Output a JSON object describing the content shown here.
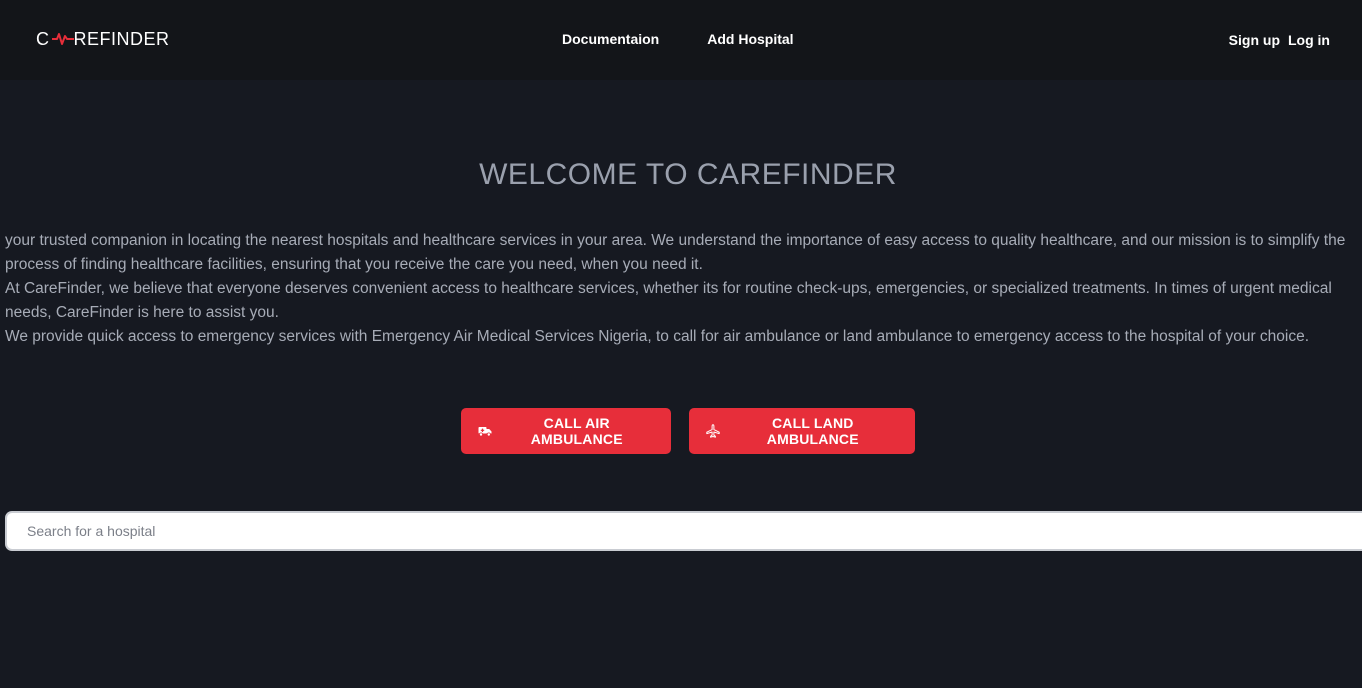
{
  "header": {
    "logo": {
      "prefix": "C",
      "suffix": "REFINDER",
      "pulse_color": "#e72e3a"
    },
    "nav": [
      {
        "label": "Documentaion"
      },
      {
        "label": "Add Hospital"
      }
    ],
    "auth": {
      "signup_label": "Sign up",
      "login_label": "Log in"
    }
  },
  "hero": {
    "title": "WELCOME TO CAREFINDER",
    "paragraphs": [
      "your trusted companion in locating the nearest hospitals and healthcare services in your area. We understand the importance of easy access to quality healthcare, and our mission is to simplify the process of finding healthcare facilities, ensuring that you receive the care you need, when you need it.",
      "At CareFinder, we believe that everyone deserves convenient access to healthcare services, whether its for routine check-ups, emergencies, or specialized treatments. In times of urgent medical needs, CareFinder is here to assist you.",
      "We provide quick access to emergency services with Emergency Air Medical Services Nigeria, to call for air ambulance or land ambulance to emergency access to the hospital of your choice."
    ]
  },
  "actions": {
    "air_ambulance": {
      "label": "CALL AIR AMBULANCE",
      "icon": "truck-icon"
    },
    "land_ambulance": {
      "label": "CALL LAND AMBULANCE",
      "icon": "plane-icon"
    }
  },
  "search": {
    "placeholder": "Search for a hospital",
    "value": ""
  },
  "colors": {
    "background": "#161921",
    "header_background": "#131519",
    "accent": "#e72e3a",
    "title_text": "#9aa0ad",
    "body_text": "#a7acb7"
  }
}
